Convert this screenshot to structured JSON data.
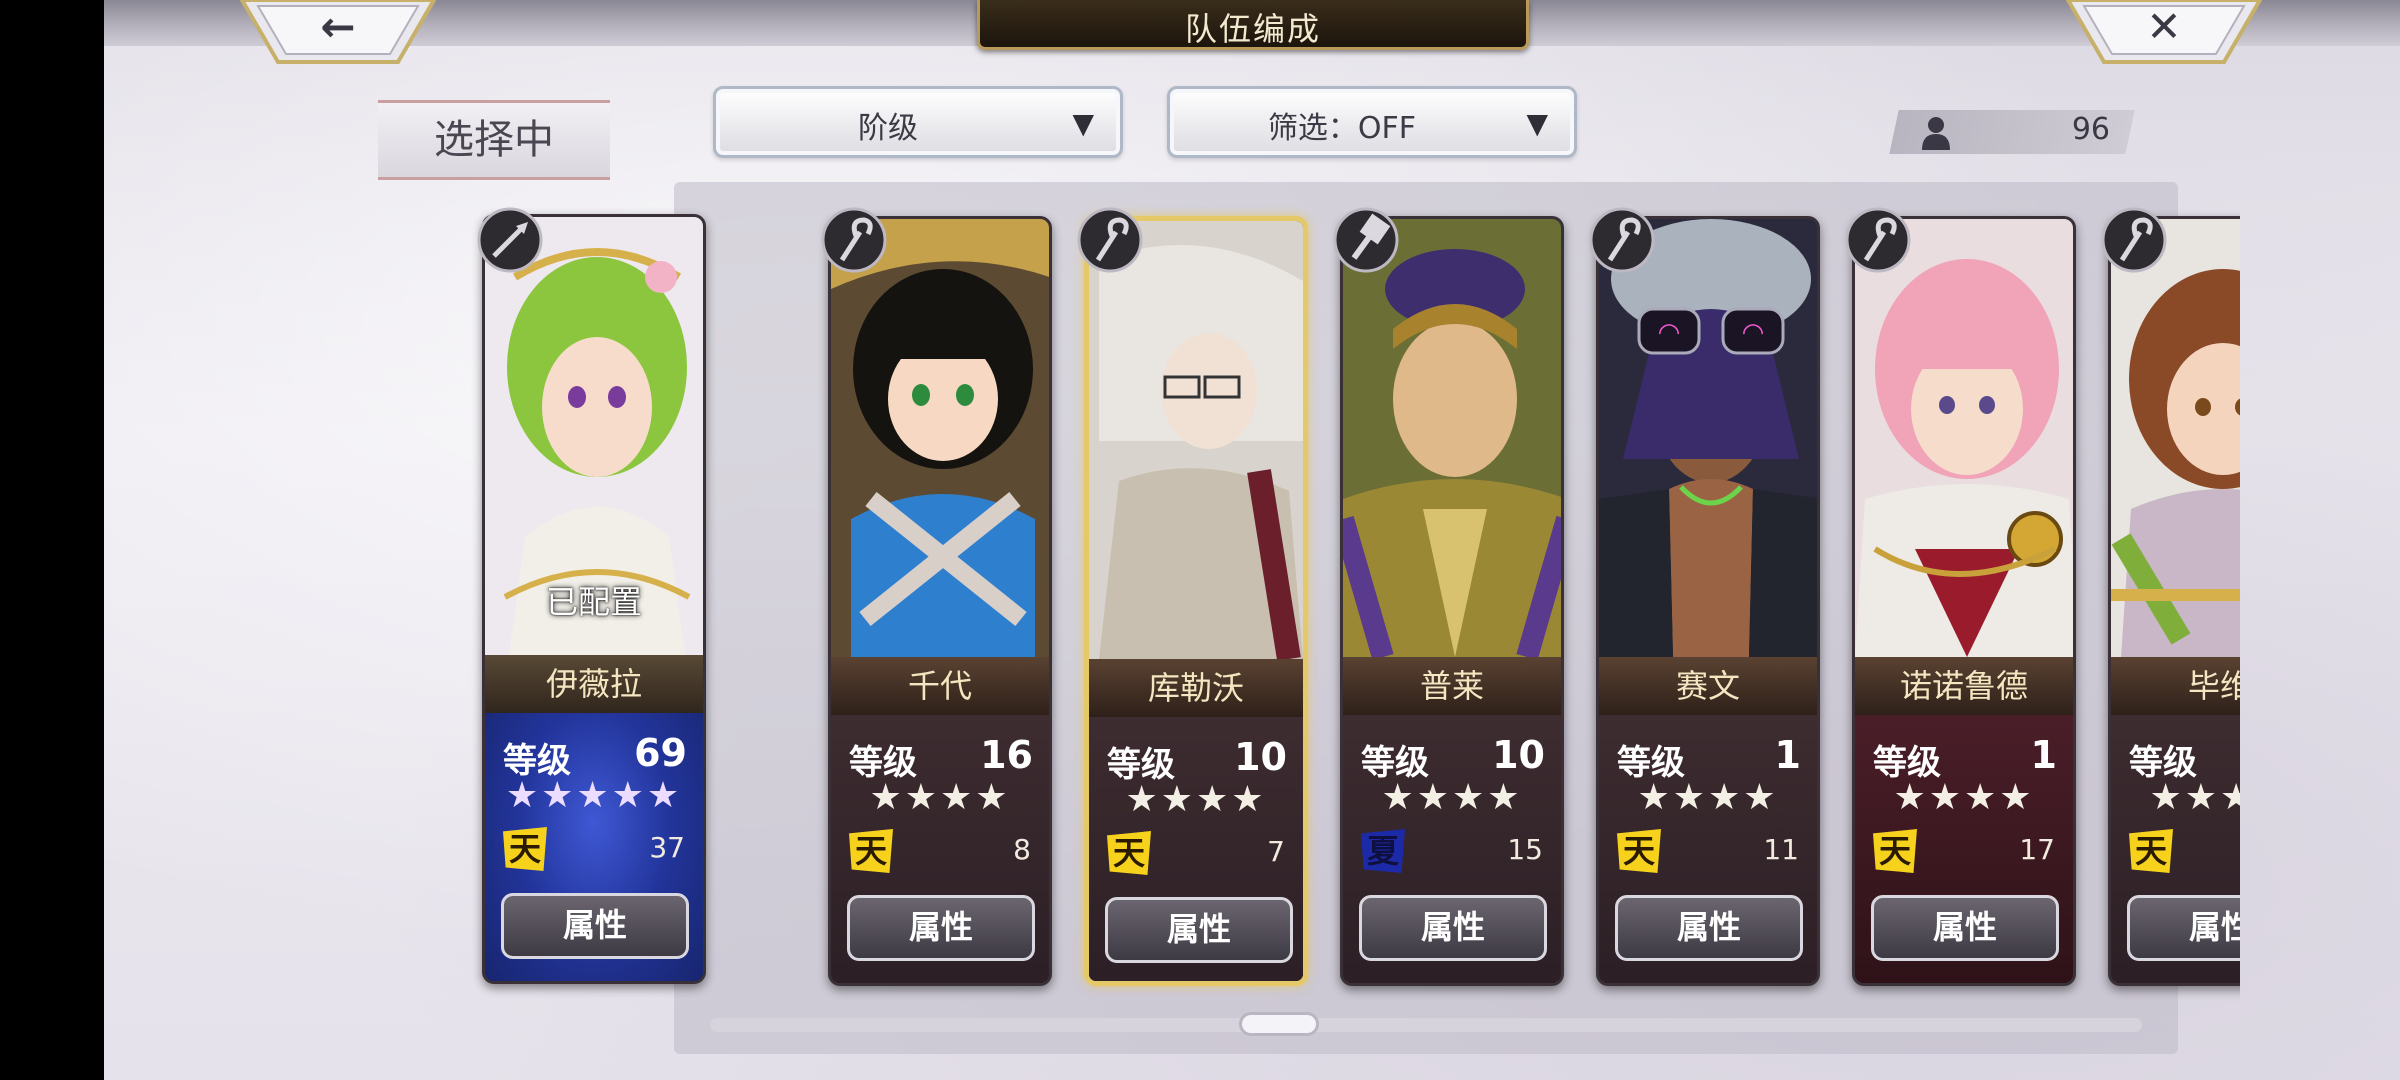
{
  "header": {
    "title": "队伍编成",
    "back_icon": "arrow-left-icon",
    "close_icon": "close-x-icon"
  },
  "selection": {
    "label": "选择中"
  },
  "filters": {
    "rank": {
      "label": "阶级",
      "icon": "chevron-down-icon"
    },
    "filter": {
      "label": "筛选：OFF",
      "icon": "chevron-down-icon"
    }
  },
  "unit_count": {
    "icon": "person-icon",
    "value": "96"
  },
  "common": {
    "level_label": "等级",
    "attr_label": "属性",
    "placed_label": "已配置"
  },
  "selected_unit": {
    "name": "伊薇拉",
    "level": "69",
    "stars": "★★★★★",
    "badge": "天",
    "badge_count": "37",
    "class_icon": "spear-icon",
    "colors": {
      "panel": "#22349a",
      "hair": "#8cc63f"
    }
  },
  "units": [
    {
      "name": "千代",
      "level": "16",
      "stars": "★★★★",
      "badge": "天",
      "badge_count": "8",
      "class_icon": "staff-icon",
      "highlight": false
    },
    {
      "name": "库勒沃",
      "level": "10",
      "stars": "★★★★",
      "badge": "天",
      "badge_count": "7",
      "class_icon": "staff-icon",
      "highlight": true
    },
    {
      "name": "普莱",
      "level": "10",
      "stars": "★★★★",
      "badge": "夏",
      "badge_count": "15",
      "class_icon": "hammer-icon",
      "highlight": false
    },
    {
      "name": "赛文",
      "level": "1",
      "stars": "★★★★",
      "badge": "天",
      "badge_count": "11",
      "class_icon": "staff-icon",
      "highlight": false
    },
    {
      "name": "诺诺鲁德",
      "level": "1",
      "stars": "★★★★",
      "badge": "天",
      "badge_count": "17",
      "class_icon": "staff-icon",
      "highlight": false
    },
    {
      "name": "毕维",
      "level": "",
      "stars": "★★★★",
      "badge": "天",
      "badge_count": "",
      "class_icon": "staff-icon",
      "highlight": false
    }
  ]
}
